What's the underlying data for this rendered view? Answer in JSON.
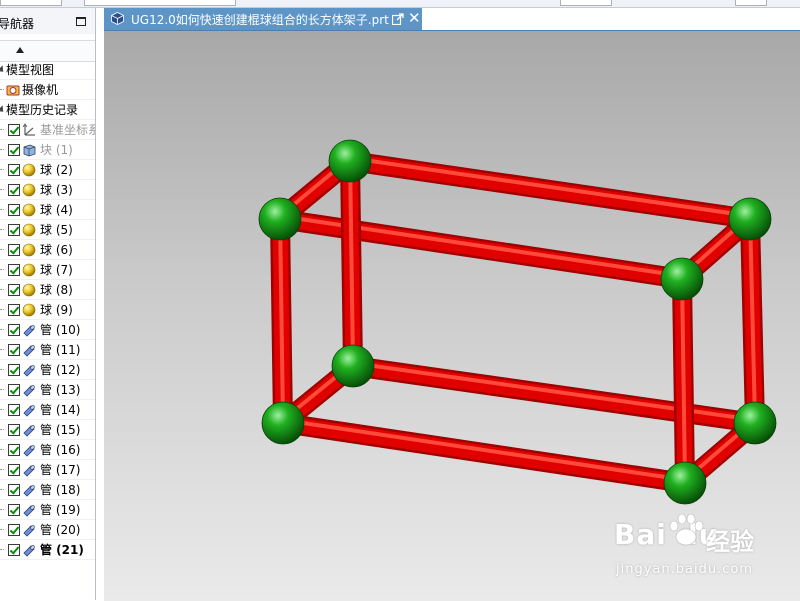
{
  "navigator": {
    "title": "导航器",
    "rows": [
      {
        "label": "模型视图",
        "kind": "folder",
        "expand": true,
        "checked": false,
        "icon": "none",
        "dim": false,
        "bold": false
      },
      {
        "label": "摄像机",
        "kind": "camera",
        "expand": false,
        "checked": false,
        "icon": "camera-icon",
        "dim": false,
        "bold": false
      },
      {
        "label": "模型历史记录",
        "kind": "folder",
        "expand": true,
        "checked": false,
        "icon": "none",
        "dim": false,
        "bold": false
      },
      {
        "label": "基准坐标系",
        "kind": "feature",
        "checked": true,
        "icon": "datum-csys-icon",
        "dim": true,
        "bold": false
      },
      {
        "label": "块 (1)",
        "kind": "feature",
        "checked": true,
        "icon": "block-icon",
        "dim": true,
        "bold": false
      },
      {
        "label": "球 (2)",
        "kind": "feature",
        "checked": true,
        "icon": "sphere-icon",
        "dim": false,
        "bold": false
      },
      {
        "label": "球 (3)",
        "kind": "feature",
        "checked": true,
        "icon": "sphere-icon",
        "dim": false,
        "bold": false
      },
      {
        "label": "球 (4)",
        "kind": "feature",
        "checked": true,
        "icon": "sphere-icon",
        "dim": false,
        "bold": false
      },
      {
        "label": "球 (5)",
        "kind": "feature",
        "checked": true,
        "icon": "sphere-icon",
        "dim": false,
        "bold": false
      },
      {
        "label": "球 (6)",
        "kind": "feature",
        "checked": true,
        "icon": "sphere-icon",
        "dim": false,
        "bold": false
      },
      {
        "label": "球 (7)",
        "kind": "feature",
        "checked": true,
        "icon": "sphere-icon",
        "dim": false,
        "bold": false
      },
      {
        "label": "球 (8)",
        "kind": "feature",
        "checked": true,
        "icon": "sphere-icon",
        "dim": false,
        "bold": false
      },
      {
        "label": "球 (9)",
        "kind": "feature",
        "checked": true,
        "icon": "sphere-icon",
        "dim": false,
        "bold": false
      },
      {
        "label": "管 (10)",
        "kind": "feature",
        "checked": true,
        "icon": "tube-icon",
        "dim": false,
        "bold": false
      },
      {
        "label": "管 (11)",
        "kind": "feature",
        "checked": true,
        "icon": "tube-icon",
        "dim": false,
        "bold": false
      },
      {
        "label": "管 (12)",
        "kind": "feature",
        "checked": true,
        "icon": "tube-icon",
        "dim": false,
        "bold": false
      },
      {
        "label": "管 (13)",
        "kind": "feature",
        "checked": true,
        "icon": "tube-icon",
        "dim": false,
        "bold": false
      },
      {
        "label": "管 (14)",
        "kind": "feature",
        "checked": true,
        "icon": "tube-icon",
        "dim": false,
        "bold": false
      },
      {
        "label": "管 (15)",
        "kind": "feature",
        "checked": true,
        "icon": "tube-icon",
        "dim": false,
        "bold": false
      },
      {
        "label": "管 (16)",
        "kind": "feature",
        "checked": true,
        "icon": "tube-icon",
        "dim": false,
        "bold": false
      },
      {
        "label": "管 (17)",
        "kind": "feature",
        "checked": true,
        "icon": "tube-icon",
        "dim": false,
        "bold": false
      },
      {
        "label": "管 (18)",
        "kind": "feature",
        "checked": true,
        "icon": "tube-icon",
        "dim": false,
        "bold": false
      },
      {
        "label": "管 (19)",
        "kind": "feature",
        "checked": true,
        "icon": "tube-icon",
        "dim": false,
        "bold": false
      },
      {
        "label": "管 (20)",
        "kind": "feature",
        "checked": true,
        "icon": "tube-icon",
        "dim": false,
        "bold": false
      },
      {
        "label": "管 (21)",
        "kind": "feature",
        "checked": true,
        "icon": "tube-icon",
        "dim": false,
        "bold": true
      }
    ]
  },
  "document": {
    "tab_title": "UG12.0如何快速创建棍球组合的长方体架子.prt",
    "close_label": "✕"
  },
  "model": {
    "tube_color": "#e00000",
    "sphere_color": "#0c9a0c"
  },
  "watermark": {
    "logo": "Bai  du",
    "brand_cn": "经验",
    "url": "jingyan.baidu.com"
  }
}
